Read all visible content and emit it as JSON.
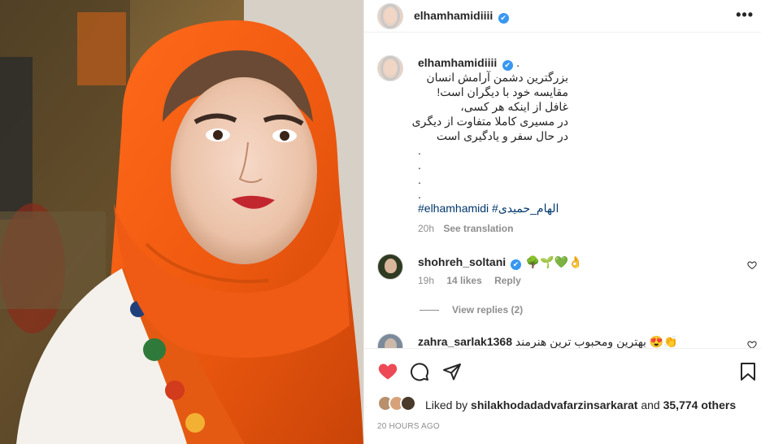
{
  "post": {
    "username": "elhamhamidiiii",
    "verified_mark": "✔",
    "more_label": "•••"
  },
  "caption": {
    "username": "elhamhamidiiii",
    "trailing": ".",
    "lines": [
      "بزرگترین دشمن آرامش انسان",
      "مقایسه خود با دیگران است!",
      "غافل از اینکه هر کسی،",
      "در مسیری کاملا متفاوت از دیگری",
      "در حال سفر و یادگیری است",
      ".",
      ".",
      ".",
      "."
    ],
    "hashtags": "#elhamhamidi #الهام_حمیدی",
    "time": "20h",
    "see_translation": "See translation"
  },
  "comments": [
    {
      "username": "shohreh_soltani",
      "text": "🌳🌱💚👌",
      "time": "19h",
      "likes": "14 likes",
      "reply": "Reply",
      "view_replies": "View replies (2)"
    },
    {
      "username": "zahra_sarlak1368",
      "text": "بهترین ومحبوب ترین هنرمند 😍👏"
    }
  ],
  "actions": {
    "like_icon": "heart-filled-icon",
    "comment_icon": "comment-icon",
    "share_icon": "share-icon",
    "save_icon": "bookmark-icon",
    "like_color": "#ed4956"
  },
  "likes": {
    "prefix": "Liked by ",
    "user": "shilakhodadadvafarzinsarkarat",
    "middle": " and ",
    "count": "35,774 others"
  },
  "timestamp": "20 HOURS AGO"
}
